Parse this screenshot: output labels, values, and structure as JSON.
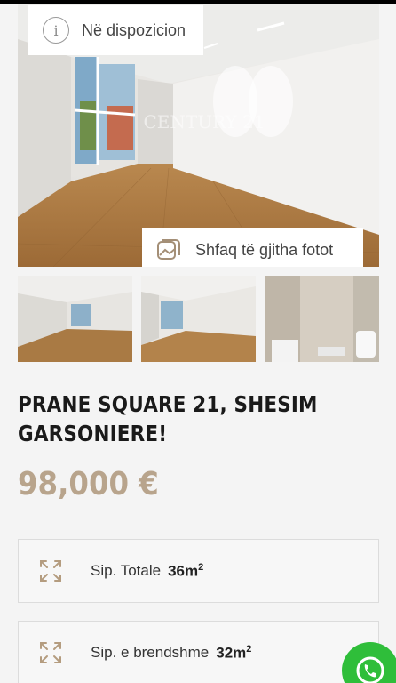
{
  "listing": {
    "status": "Në dispozicion",
    "show_all_photos": "Shfaq të gjitha fotot",
    "watermark": "CENTURY 21",
    "title_line1": "PRANE SQUARE 21, SHESIM",
    "title_line2": "GARSONIERE!",
    "price": "98,000 €",
    "features": [
      {
        "label": "Sip. Totale",
        "value": "36m",
        "unit_sup": "2",
        "icon": "expand-arrows-icon"
      },
      {
        "label": "Sip. e brendshme",
        "value": "32m",
        "unit_sup": "2",
        "icon": "expand-arrows-icon"
      }
    ]
  },
  "colors": {
    "accent": "#b8a48c",
    "whatsapp": "#2fbe3a"
  }
}
